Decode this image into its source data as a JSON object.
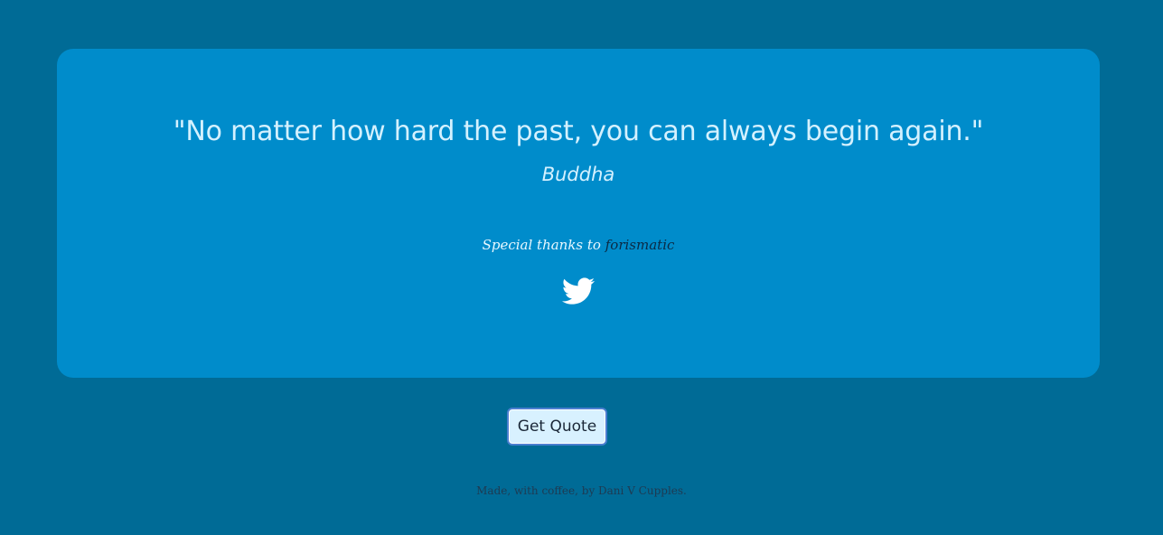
{
  "quote": {
    "text": "\"No matter how hard the past, you can always begin again.\"",
    "author": "Buddha"
  },
  "credits": {
    "thanks_prefix": "Special thanks to",
    "thanks_link": "forismatic"
  },
  "share": {
    "icon": "twitter-bird-icon"
  },
  "actions": {
    "get_quote_label": "Get Quote"
  },
  "footer": {
    "text": "Made, with coffee, by Dani V Cupples."
  },
  "colors": {
    "background": "#006b96",
    "card": "#008ccb",
    "quote_text": "#d4f1ff",
    "link": "#0b2a44",
    "button_bg": "#d8f1ff",
    "button_border": "#4b7fd0"
  }
}
